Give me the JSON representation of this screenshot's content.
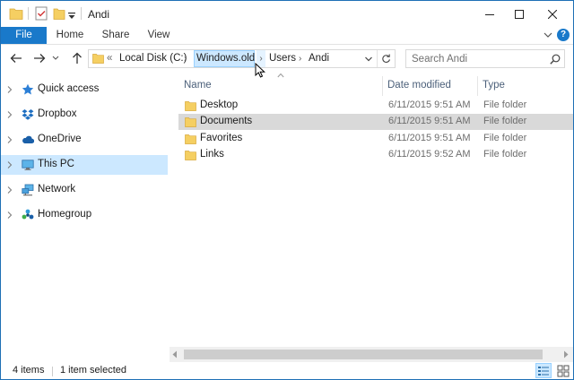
{
  "window": {
    "title": "Andi"
  },
  "ribbon": {
    "tabs": [
      "File",
      "Home",
      "Share",
      "View"
    ],
    "help": "?"
  },
  "address": {
    "overflow": "«",
    "crumbs": [
      "Local Disk (C:)",
      "Windows.old",
      "Users",
      "Andi"
    ],
    "separator": "›"
  },
  "search": {
    "placeholder": "Search Andi"
  },
  "nav": {
    "items": [
      {
        "label": "Quick access",
        "icon": "star-icon"
      },
      {
        "label": "Dropbox",
        "icon": "dropbox-icon"
      },
      {
        "label": "OneDrive",
        "icon": "cloud-icon"
      },
      {
        "label": "This PC",
        "icon": "computer-icon",
        "selected": true
      },
      {
        "label": "Network",
        "icon": "network-icon"
      },
      {
        "label": "Homegroup",
        "icon": "homegroup-icon"
      }
    ]
  },
  "columns": {
    "name": "Name",
    "date": "Date modified",
    "type": "Type"
  },
  "files": [
    {
      "name": "Desktop",
      "date": "6/11/2015 9:51 AM",
      "type": "File folder"
    },
    {
      "name": "Documents",
      "date": "6/11/2015 9:51 AM",
      "type": "File folder",
      "selected": true
    },
    {
      "name": "Favorites",
      "date": "6/11/2015 9:51 AM",
      "type": "File folder"
    },
    {
      "name": "Links",
      "date": "6/11/2015 9:52 AM",
      "type": "File folder"
    }
  ],
  "status": {
    "items": "4 items",
    "selected": "1 item selected"
  },
  "colors": {
    "accent": "#1979ca",
    "selection": "#cce8ff",
    "row_selected": "#d9d9d9",
    "folder": "#f5cf62"
  }
}
